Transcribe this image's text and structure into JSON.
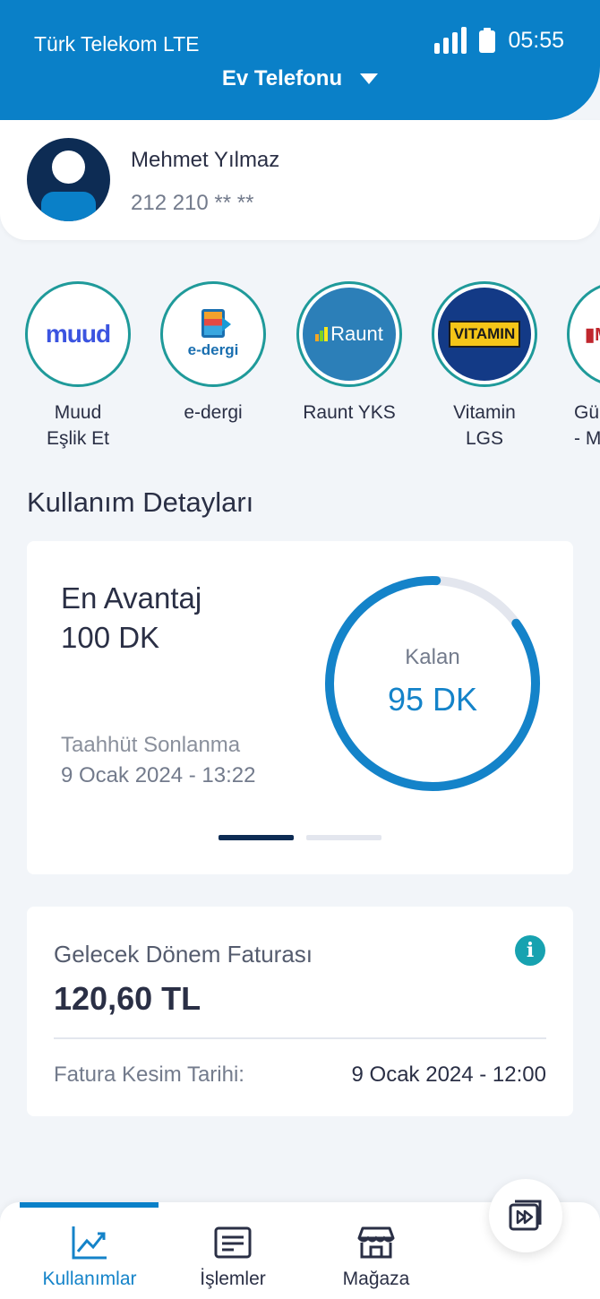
{
  "status_bar": {
    "carrier": "Türk Telekom LTE",
    "time": "05:55",
    "signal_icon": "signal-icon",
    "battery_icon": "battery-icon"
  },
  "header": {
    "line_selector": "Ev Telefonu",
    "caret_icon": "chevron-down-icon"
  },
  "profile": {
    "name": "Mehmet Yılmaz",
    "phone": "212 210 ** **"
  },
  "services": [
    {
      "label": "Muud\nEşlik Et",
      "logo": "muud",
      "logo_text": "muud"
    },
    {
      "label": "e-dergi",
      "logo": "e-dergi",
      "logo_text": "e-dergi"
    },
    {
      "label": "Raunt YKS",
      "logo": "raunt",
      "logo_text": "Raunt"
    },
    {
      "label": "Vitamin\nLGS",
      "logo": "vitamin",
      "logo_text": "VITAMIN"
    },
    {
      "label": "Gü\n- M",
      "logo": "partial",
      "logo_text": ""
    }
  ],
  "usage": {
    "section_title": "Kullanım Detayları",
    "plan_name": "En Avantaj\n100 DK",
    "commitment_label": "Taahhüt Sonlanma",
    "commitment_date": "9 Ocak 2024 - 13:22",
    "remaining_label": "Kalan",
    "remaining_value": "95 DK",
    "remaining_fraction": 0.95,
    "pager": {
      "total": 2,
      "active": 0
    },
    "colors": {
      "ring": "#1483c9",
      "track": "#e3e6ee"
    }
  },
  "invoice": {
    "title": "Gelecek Dönem Faturası",
    "amount": "120,60 TL",
    "info_icon": "info-icon",
    "date_label": "Fatura Kesim Tarihi:",
    "date_value": "9 Ocak 2024 - 12:00"
  },
  "bottom_nav": {
    "items": [
      {
        "label": "Kullanımlar",
        "icon": "chart-line-icon",
        "active": true
      },
      {
        "label": "İşlemler",
        "icon": "list-icon",
        "active": false
      },
      {
        "label": "Mağaza",
        "icon": "store-icon",
        "active": false
      }
    ],
    "fab_icon": "video-play-icon"
  },
  "colors": {
    "brand": "#0a80c8",
    "navy": "#0d2c54",
    "teal": "#17a2b0",
    "background": "#f2f5f9"
  }
}
